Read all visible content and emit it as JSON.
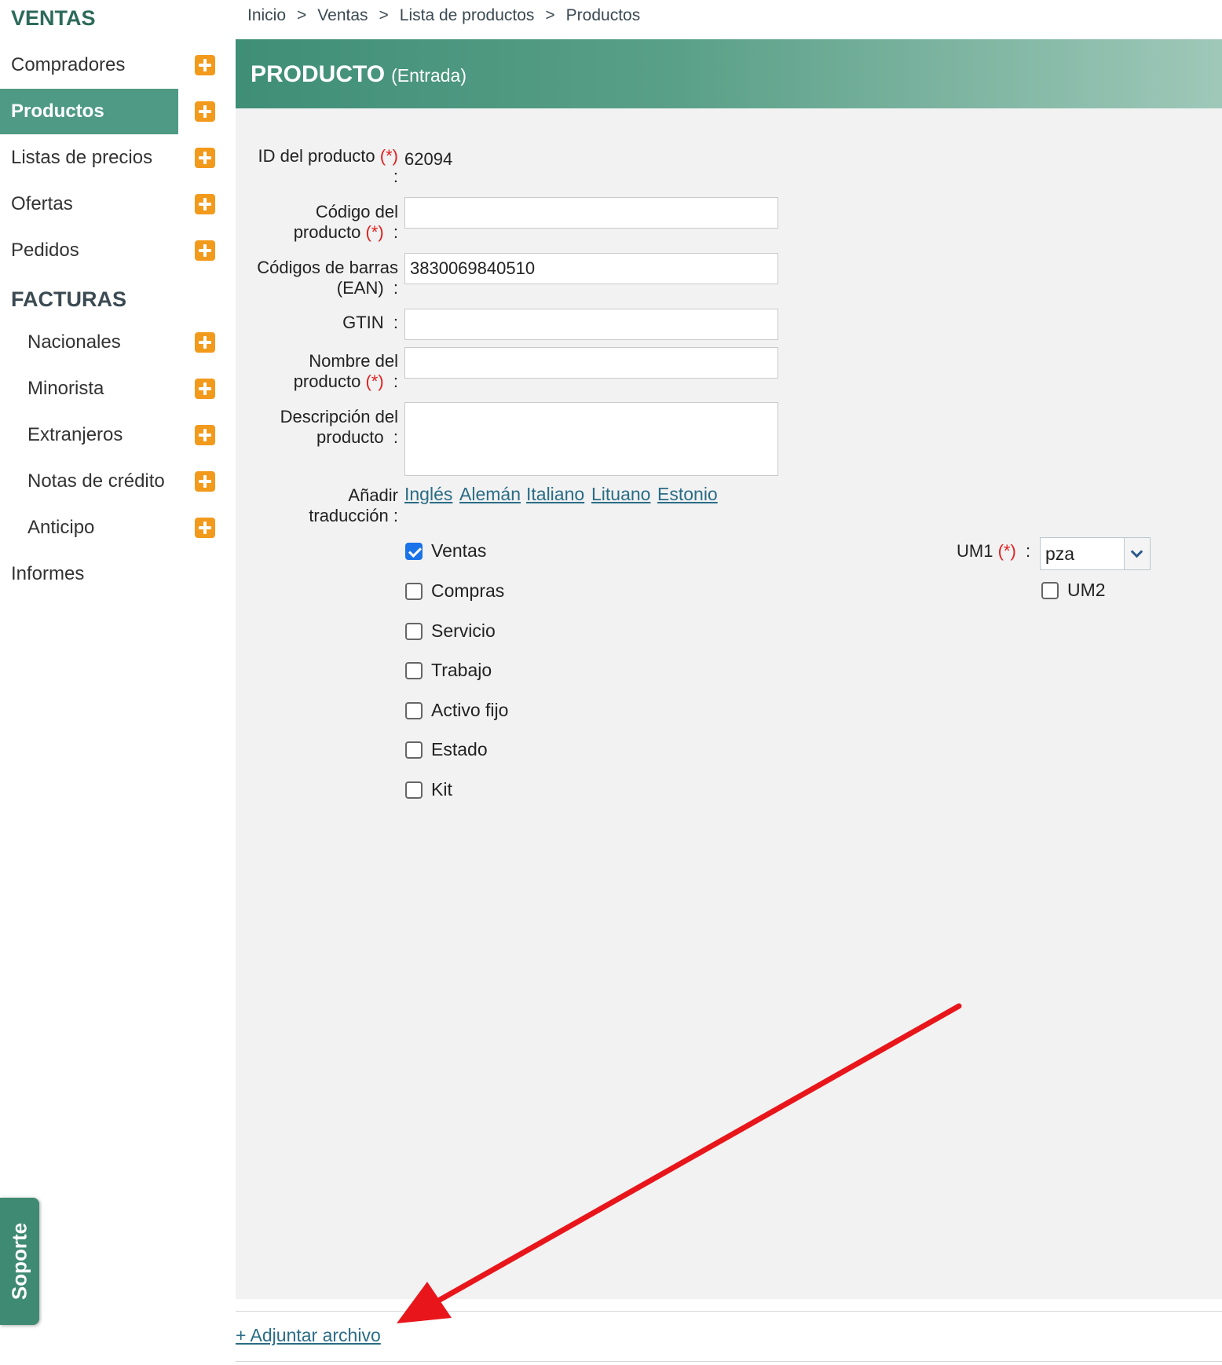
{
  "sidebar": {
    "ventas_title": "VENTAS",
    "ventas_items": [
      {
        "label": "Compradores"
      },
      {
        "label": "Productos"
      },
      {
        "label": "Listas de precios"
      },
      {
        "label": "Ofertas"
      },
      {
        "label": "Pedidos"
      }
    ],
    "facturas_title": "FACTURAS",
    "facturas_items": [
      {
        "label": "Nacionales"
      },
      {
        "label": "Minorista"
      },
      {
        "label": "Extranjeros"
      },
      {
        "label": "Notas de crédito"
      },
      {
        "label": "Anticipo"
      }
    ],
    "informes_label": "Informes",
    "soporte_label": "Soporte",
    "active_item": "Productos"
  },
  "breadcrumb": [
    "Inicio",
    "Ventas",
    "Lista de productos",
    "Productos"
  ],
  "breadcrumb_sep": ">",
  "header": {
    "title": "PRODUCTO",
    "subtitle": "(Entrada)"
  },
  "form": {
    "required_marker": "(*)",
    "id_label": "ID del producto",
    "id_value": "62094",
    "code_label_1": "Código del",
    "code_label_2": "producto",
    "code_value": "",
    "barcode_label_1": "Códigos de barras",
    "barcode_label_2": "(EAN)",
    "barcode_value": "3830069840510",
    "gtin_label": "GTIN",
    "gtin_value": "",
    "name_label_1": "Nombre del",
    "name_label_2": "producto",
    "name_value": "",
    "desc_label_1": "Descripción del",
    "desc_label_2": "producto",
    "desc_value": "",
    "translation_label_1": "Añadir",
    "translation_label_2": "traducción",
    "translations": [
      "Inglés",
      "Alemán",
      "Italiano",
      "Lituano",
      "Estonio"
    ],
    "checkboxes": [
      {
        "label": "Ventas",
        "checked": true
      },
      {
        "label": "Compras",
        "checked": false
      },
      {
        "label": "Servicio",
        "checked": false
      },
      {
        "label": "Trabajo",
        "checked": false
      },
      {
        "label": "Activo fijo",
        "checked": false
      },
      {
        "label": "Estado",
        "checked": false
      },
      {
        "label": "Kit",
        "checked": false
      }
    ],
    "um1_label": "UM1",
    "um1_value": "pza",
    "um2_label": "UM2",
    "um2_checked": false
  },
  "attach_label": "+ Adjuntar archivo",
  "colors": {
    "accent": "#4e9a84",
    "plus": "#f29a1c",
    "link": "#2a6c86",
    "required": "#e02020",
    "arrow": "#e8161b"
  }
}
